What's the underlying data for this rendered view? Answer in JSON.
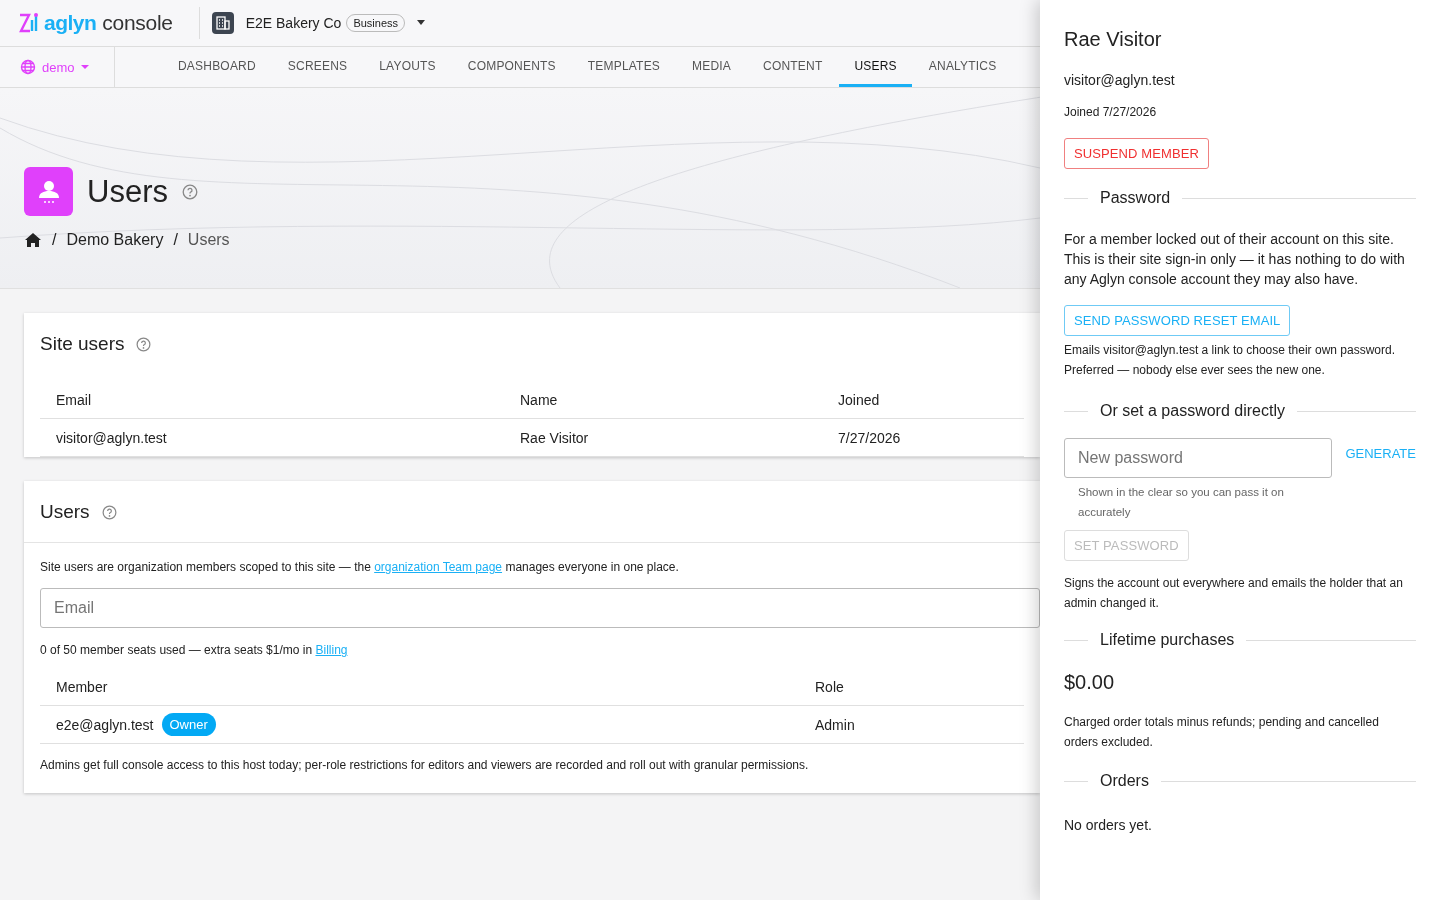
{
  "header": {
    "logo": {
      "brand": "aglyn",
      "product": "console"
    },
    "org": {
      "name": "E2E Bakery Co",
      "plan": "Business"
    },
    "site": {
      "name": "demo"
    },
    "tabs": [
      {
        "label": "DASHBOARD",
        "selected": false
      },
      {
        "label": "SCREENS",
        "selected": false
      },
      {
        "label": "LAYOUTS",
        "selected": false
      },
      {
        "label": "COMPONENTS",
        "selected": false
      },
      {
        "label": "TEMPLATES",
        "selected": false
      },
      {
        "label": "MEDIA",
        "selected": false
      },
      {
        "label": "CONTENT",
        "selected": false
      },
      {
        "label": "USERS",
        "selected": true
      },
      {
        "label": "ANALYTICS",
        "selected": false
      }
    ]
  },
  "page_header": {
    "title": "Users",
    "breadcrumb": [
      {
        "separator": "/",
        "label": "Demo Bakery"
      },
      {
        "separator": "/",
        "label": "Users"
      }
    ]
  },
  "site_users": {
    "title": "Site users",
    "columns": [
      "Email",
      "Name",
      "Joined"
    ],
    "rows": [
      {
        "email": "visitor@aglyn.test",
        "name": "Rae Visitor",
        "joined": "7/27/2026"
      }
    ]
  },
  "users": {
    "title": "Users",
    "intro": {
      "before": "Site users are organization members scoped to this site — the",
      "link": "organization Team page",
      "after": "manages everyone in one place."
    },
    "email_field": {
      "placeholder": "Email"
    },
    "seats": {
      "text": "0 of 50 member seats used — extra seats $1/mo in",
      "link": "Billing"
    },
    "columns": [
      "Member",
      "Role"
    ],
    "rows": [
      {
        "member": "e2e@aglyn.test",
        "badge": "Owner",
        "role": "Admin"
      }
    ],
    "footnote": "Admins get full console access to this host today; per-role restrictions for editors and viewers are recorded and roll out with granular permissions."
  },
  "drawer": {
    "name": "Rae Visitor",
    "email": "visitor@aglyn.test",
    "joined": "Joined 7/27/2026",
    "suspend_button": "SUSPEND MEMBER",
    "password_section": {
      "title": "Password",
      "description": "For a member locked out of their account on this site. This is their site sign-in only — it has nothing to do with any Aglyn console account they may also have.",
      "reset_button": "SEND PASSWORD RESET EMAIL",
      "reset_note": "Emails visitor@aglyn.test a link to choose their own password. Preferred — nobody else ever sees the new one."
    },
    "direct_section": {
      "title": "Or set a password directly",
      "field": {
        "placeholder": "New password"
      },
      "generate_button": "GENERATE",
      "hint": "Shown in the clear so you can pass it on accurately",
      "set_button": {
        "label": "SET PASSWORD",
        "disabled": true
      },
      "note": "Signs the account out everywhere and emails the holder that an admin changed it."
    },
    "purchases_section": {
      "title": "Lifetime purchases",
      "amount": "$0.00",
      "note": "Charged order totals minus refunds; pending and cancelled orders excluded."
    },
    "orders_section": {
      "title": "Orders",
      "empty_text": "No orders yet."
    }
  }
}
